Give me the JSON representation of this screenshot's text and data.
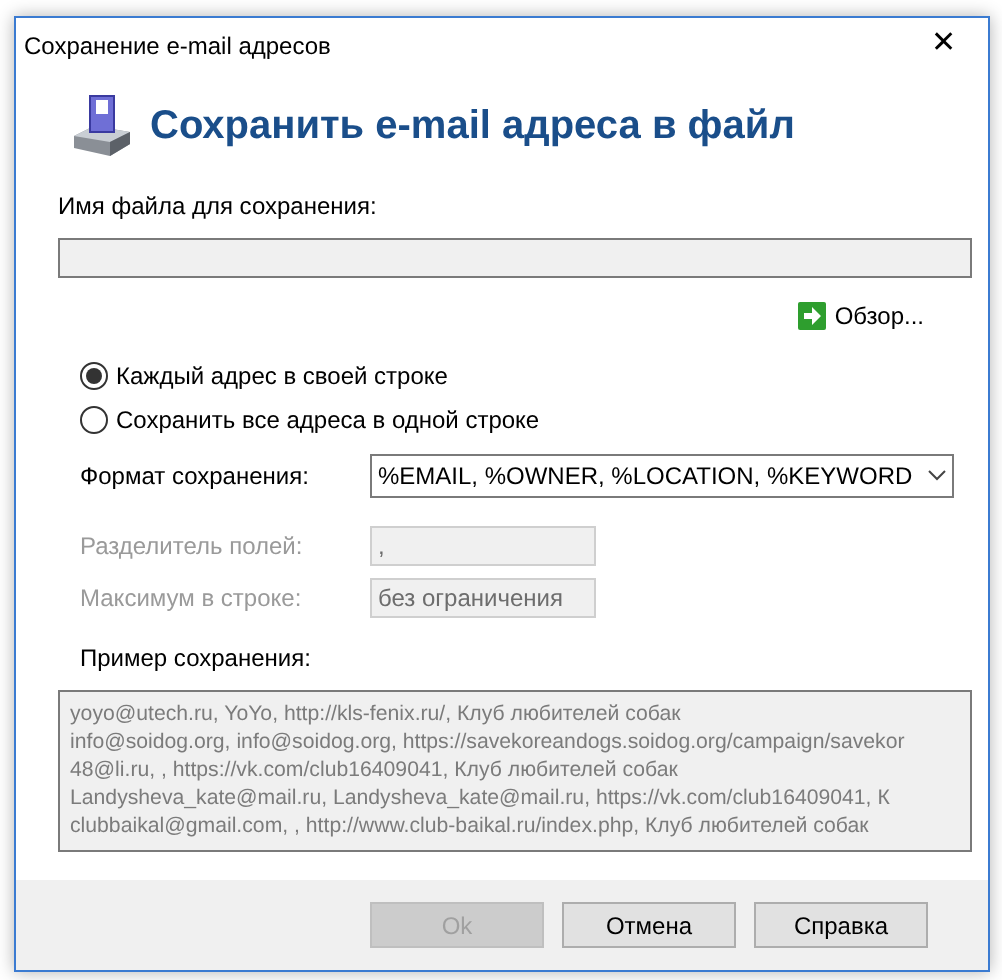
{
  "window": {
    "title": "Сохранение e-mail адресов",
    "close": "✕"
  },
  "header": {
    "title": "Сохранить e-mail адреса в файл"
  },
  "file": {
    "label": "Имя файла для сохранения:",
    "browse": "Обзор..."
  },
  "modes": [
    {
      "label": "Каждый адрес в своей строке",
      "selected": true
    },
    {
      "label": "Сохранить все адреса в одной строке",
      "selected": false
    }
  ],
  "fields": [
    {
      "kind": "select",
      "label": "Формат сохранения:",
      "value": "%EMAIL, %OWNER, %LOCATION, %KEYWORD",
      "disabled": false
    },
    {
      "kind": "text",
      "label": "Разделитель полей:",
      "value": ",",
      "disabled": true
    },
    {
      "kind": "text",
      "label": "Максимум в строке:",
      "value": "без ограничения",
      "disabled": true
    }
  ],
  "sample": {
    "label": "Пример сохранения:",
    "lines": [
      "yoyo@utech.ru, YoYo, http://kls-fenix.ru/, Клуб любителей собак",
      "info@soidog.org, info@soidog.org, https://savekoreandogs.soidog.org/campaign/savekor",
      "48@li.ru, , https://vk.com/club16409041, Клуб любителей собак",
      "Landysheva_kate@mail.ru, Landysheva_kate@mail.ru, https://vk.com/club16409041, К",
      "clubbaikal@gmail.com, , http://www.club-baikal.ru/index.php, Клуб любителей собак"
    ]
  },
  "buttons": [
    {
      "label": "Ok",
      "disabled": true
    },
    {
      "label": "Отмена",
      "disabled": false
    },
    {
      "label": "Справка",
      "disabled": false
    }
  ]
}
